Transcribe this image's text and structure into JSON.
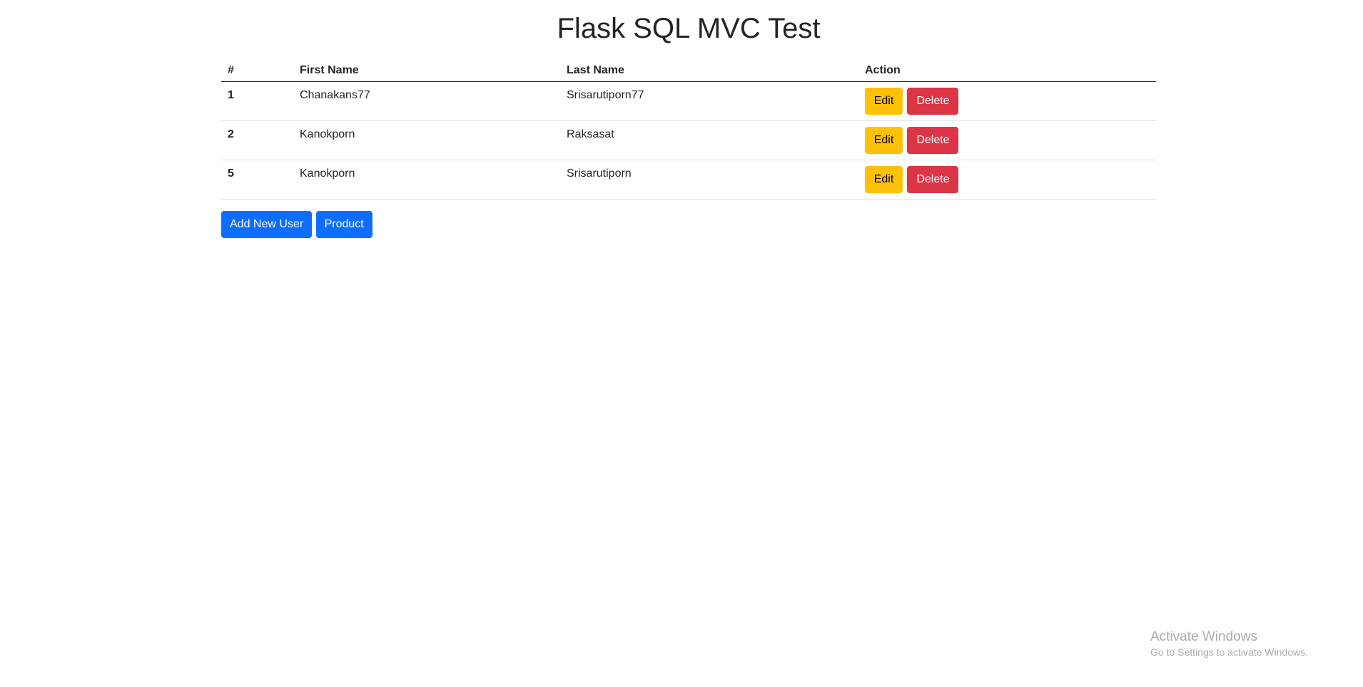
{
  "page": {
    "title": "Flask SQL MVC Test"
  },
  "table": {
    "headers": {
      "id": "#",
      "first_name": "First Name",
      "last_name": "Last Name",
      "action": "Action"
    },
    "rows": [
      {
        "id": "1",
        "first_name": "Chanakans77",
        "last_name": "Srisarutiporn77",
        "edit_label": "Edit",
        "delete_label": "Delete"
      },
      {
        "id": "2",
        "first_name": "Kanokporn",
        "last_name": "Raksasat",
        "edit_label": "Edit",
        "delete_label": "Delete"
      },
      {
        "id": "5",
        "first_name": "Kanokporn",
        "last_name": "Srisarutiporn",
        "edit_label": "Edit",
        "delete_label": "Delete"
      }
    ]
  },
  "actions": {
    "add_user_label": "Add New User",
    "product_label": "Product"
  },
  "watermark": {
    "title": "Activate Windows",
    "subtitle": "Go to Settings to activate Windows."
  },
  "colors": {
    "edit": "#ffc107",
    "delete": "#dc3545",
    "primary": "#0d6efd"
  }
}
